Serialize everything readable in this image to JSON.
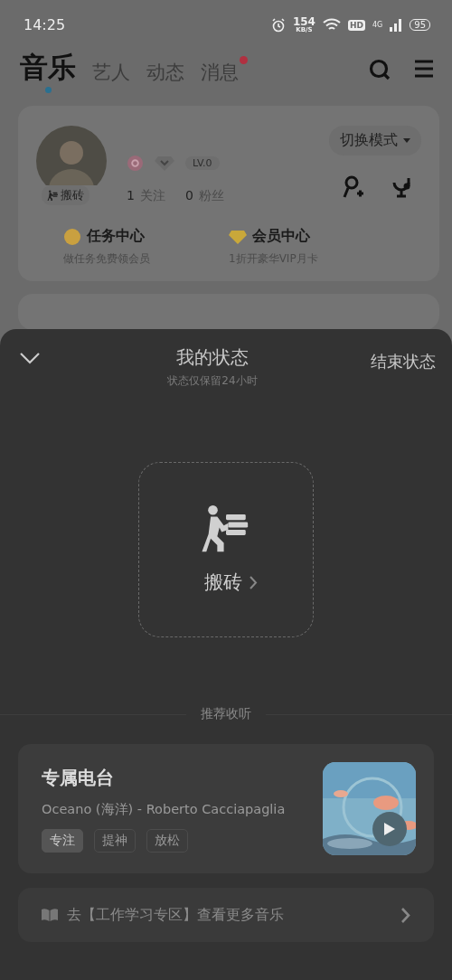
{
  "status_bar": {
    "time": "14:25",
    "net_speed": "154",
    "net_unit": "KB/S",
    "hd": "HD",
    "network": "4G",
    "battery": "95"
  },
  "tabs": [
    {
      "label": "音乐",
      "selected": true,
      "dot": false
    },
    {
      "label": "艺人",
      "selected": false,
      "dot": false
    },
    {
      "label": "动态",
      "selected": false,
      "dot": false
    },
    {
      "label": "消息",
      "selected": false,
      "dot": true
    }
  ],
  "profile": {
    "status_tag": "搬砖",
    "level": "LV.0",
    "following_count": "1",
    "following_label": "关注",
    "fans_count": "0",
    "fans_label": "粉丝",
    "mode_button": "切换模式",
    "shortcuts": [
      {
        "title": "任务中心",
        "subtitle": "做任务免费领会员",
        "color": "#c9a040"
      },
      {
        "title": "会员中心",
        "subtitle": "1折开豪华VIP月卡",
        "color": "#c9a83a"
      }
    ]
  },
  "sheet": {
    "title": "我的状态",
    "subtitle": "状态仅保留24小时",
    "end_button": "结束状态",
    "status_label": "搬砖",
    "section_title": "推荐收听",
    "radio": {
      "title": "专属电台",
      "track": "Oceano (海洋) - Roberto Cacciapaglia",
      "tags": [
        {
          "label": "专注",
          "selected": true
        },
        {
          "label": "提神",
          "selected": false
        },
        {
          "label": "放松",
          "selected": false
        }
      ]
    },
    "link": "去【工作学习专区】查看更多音乐"
  }
}
